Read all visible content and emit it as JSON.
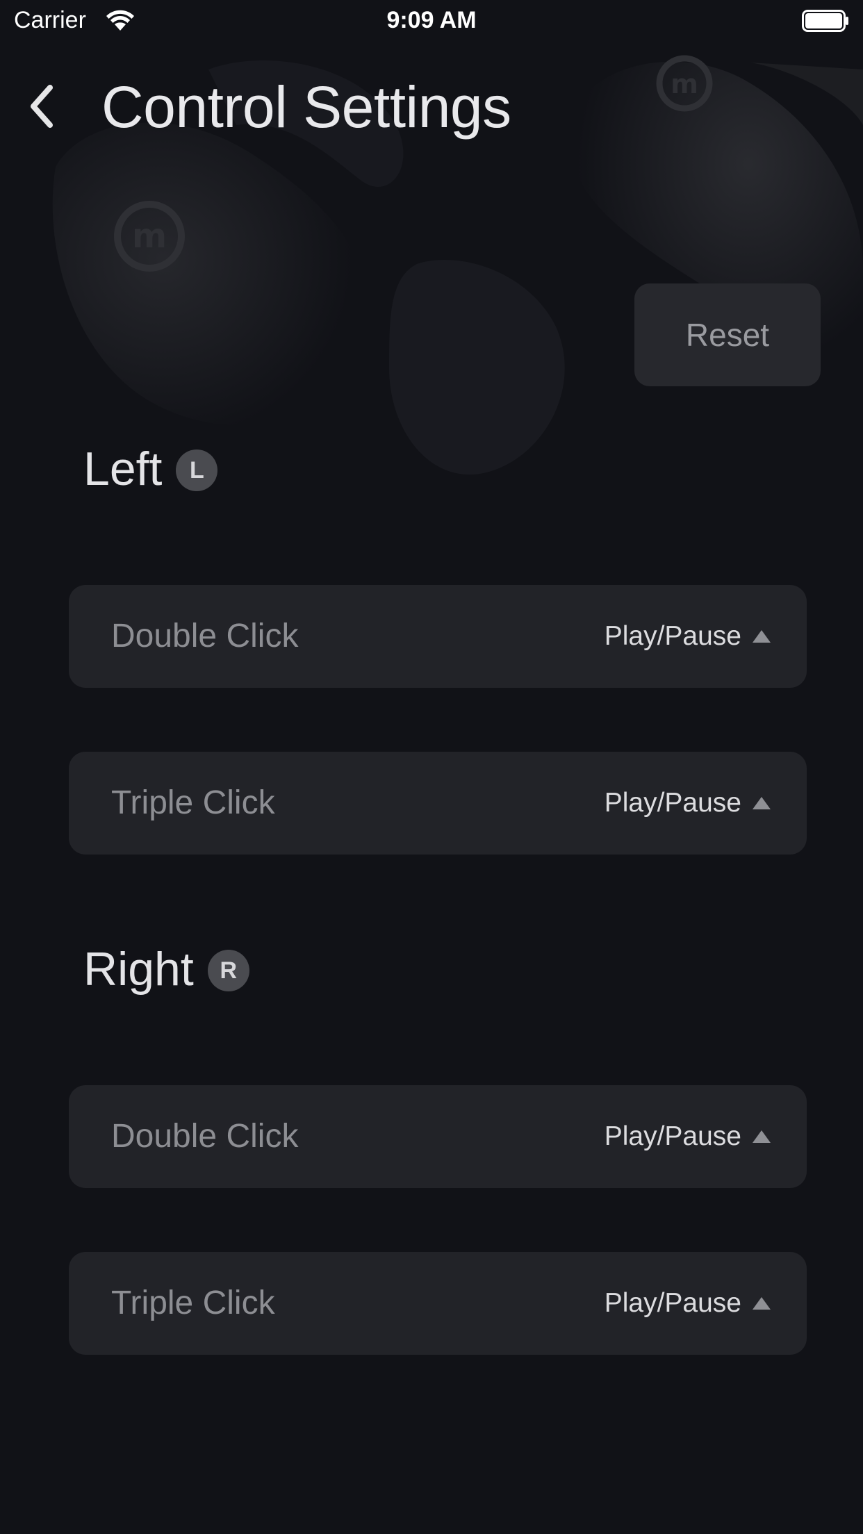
{
  "status_bar": {
    "carrier": "Carrier",
    "time": "9:09 AM",
    "wifi_icon": "wifi-icon",
    "battery_icon": "battery-icon"
  },
  "header": {
    "back_icon": "chevron-left-icon",
    "title": "Control Settings"
  },
  "reset_label": "Reset",
  "sections": [
    {
      "title": "Left",
      "badge": "L",
      "rows": [
        {
          "label": "Double Click",
          "value": "Play/Pause"
        },
        {
          "label": "Triple Click",
          "value": "Play/Pause"
        }
      ]
    },
    {
      "title": "Right",
      "badge": "R",
      "rows": [
        {
          "label": "Double Click",
          "value": "Play/Pause"
        },
        {
          "label": "Triple Click",
          "value": "Play/Pause"
        }
      ]
    }
  ],
  "colors": {
    "background": "#111217",
    "card": "#222328",
    "badge": "#4a4b50",
    "reset_button": "#27282d"
  }
}
